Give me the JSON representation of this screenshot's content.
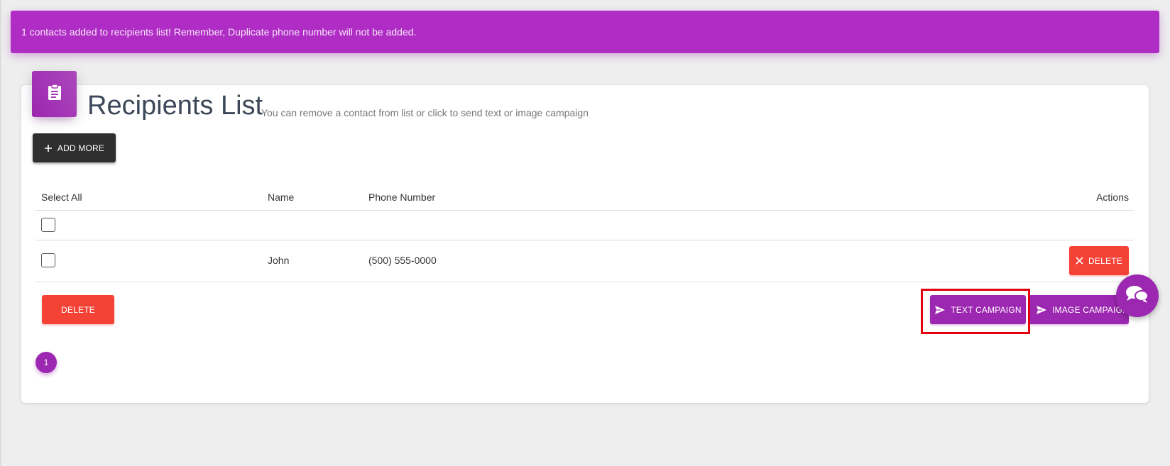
{
  "alert": {
    "message": "1 contacts added to recipients list! Remember, Duplicate phone number will not be added."
  },
  "header": {
    "title": "Recipients List",
    "subtitle": "You can remove a contact from list or click to send text or image campaign"
  },
  "toolbar": {
    "add_more_label": "ADD MORE"
  },
  "table": {
    "columns": [
      "Select All",
      "Name",
      "Phone Number",
      "Actions"
    ],
    "rows": [
      {
        "name": "John",
        "phone": "(500) 555-0000",
        "action_label": "DELETE"
      }
    ]
  },
  "footer_actions": {
    "delete_label": "DELETE",
    "text_campaign_label": "TEXT CAMPAIGN",
    "image_campaign_label": "IMAGE CAMPAIGN"
  },
  "pagination": {
    "current_page": "1"
  },
  "colors": {
    "accent": "#9c27b0",
    "alert_bg": "#b02dc5",
    "danger": "#f44336",
    "dark_button": "#2f2f2f",
    "highlight": "#e3000f"
  },
  "icons": {
    "card_icon": "clipboard-icon",
    "add_icon": "plus-icon",
    "delete_icon": "close-icon",
    "send_icon": "send-icon",
    "chat_icon": "chat-icon"
  }
}
